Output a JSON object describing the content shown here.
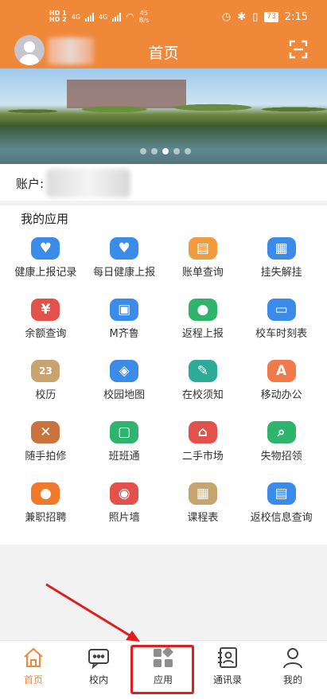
{
  "status_bar": {
    "sim1": "HD 1",
    "sim2": "HD 2",
    "net1": "4G",
    "net2": "4G",
    "speed_value": "45",
    "speed_unit": "B/s",
    "battery": "73",
    "time": "2:15"
  },
  "header": {
    "title": "首页"
  },
  "banner": {
    "slide_count": 5,
    "active_slide": 3
  },
  "account": {
    "label": "账户:"
  },
  "apps": {
    "section_title": "我的应用",
    "items": [
      {
        "label": "健康上报记录",
        "icon": "heart-icon",
        "color": "#3b8be8",
        "glyph": "♥"
      },
      {
        "label": "每日健康上报",
        "icon": "heart-icon",
        "color": "#3b8be8",
        "glyph": "♥"
      },
      {
        "label": "账单查询",
        "icon": "wallet-icon",
        "color": "#f19a3e",
        "glyph": "▤"
      },
      {
        "label": "挂失解挂",
        "icon": "document-icon",
        "color": "#3b8be8",
        "glyph": "▦"
      },
      {
        "label": "余额查询",
        "icon": "yen-icon",
        "color": "#e2524a",
        "glyph": "¥"
      },
      {
        "label": "M齐鲁",
        "icon": "briefcase-icon",
        "color": "#3b8be8",
        "glyph": "▣"
      },
      {
        "label": "返程上报",
        "icon": "person-location-icon",
        "color": "#2fb46e",
        "glyph": "●"
      },
      {
        "label": "校车时刻表",
        "icon": "bus-icon",
        "color": "#3b8be8",
        "glyph": "▭"
      },
      {
        "label": "校历",
        "icon": "calendar-icon",
        "color": "#c7a36d",
        "glyph": "23"
      },
      {
        "label": "校园地图",
        "icon": "map-icon",
        "color": "#3b8be8",
        "glyph": "◈"
      },
      {
        "label": "在校须知",
        "icon": "notebook-icon",
        "color": "#2bab98",
        "glyph": "✎"
      },
      {
        "label": "移动办公",
        "icon": "office-icon",
        "color": "#f07a4a",
        "glyph": "A"
      },
      {
        "label": "随手拍修",
        "icon": "tools-icon",
        "color": "#c9743e",
        "glyph": "✕"
      },
      {
        "label": "班班通",
        "icon": "portrait-icon",
        "color": "#2fb46e",
        "glyph": "▢"
      },
      {
        "label": "二手市场",
        "icon": "shop-icon",
        "color": "#e2524a",
        "glyph": "⌂"
      },
      {
        "label": "失物招领",
        "icon": "search-box-icon",
        "color": "#2fb46e",
        "glyph": "⌕"
      },
      {
        "label": "兼职招聘",
        "icon": "worker-icon",
        "color": "#f07a2a",
        "glyph": "●"
      },
      {
        "label": "照片墙",
        "icon": "camera-icon",
        "color": "#e2524a",
        "glyph": "◉"
      },
      {
        "label": "课程表",
        "icon": "schedule-icon",
        "color": "#c7a36d",
        "glyph": "▦"
      },
      {
        "label": "返校信息查询",
        "icon": "id-card-icon",
        "color": "#3b8be8",
        "glyph": "▤"
      }
    ]
  },
  "nav": {
    "items": [
      {
        "label": "首页",
        "icon": "home-icon"
      },
      {
        "label": "校内",
        "icon": "chat-icon"
      },
      {
        "label": "应用",
        "icon": "apps-icon"
      },
      {
        "label": "通讯录",
        "icon": "contacts-icon"
      },
      {
        "label": "我的",
        "icon": "user-icon"
      }
    ],
    "active": "首页",
    "highlighted": "应用"
  },
  "colors": {
    "brand": "#f0883a",
    "highlight": "#e11d1d"
  }
}
